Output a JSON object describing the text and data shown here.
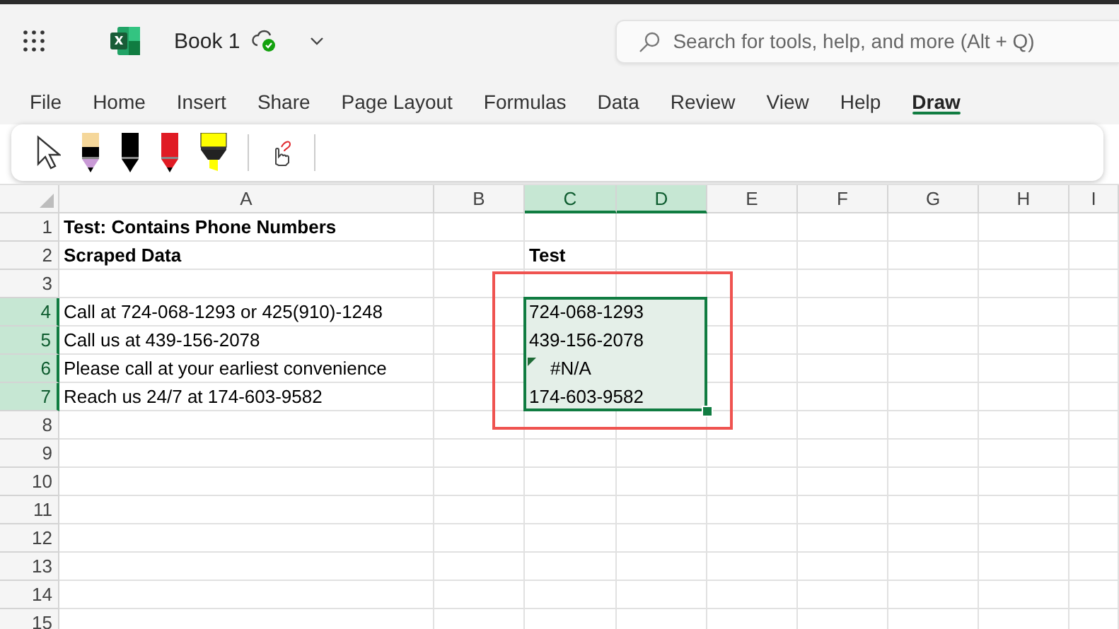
{
  "app": {
    "document_title": "Book 1",
    "search": {
      "placeholder": "Search for tools, help, and more (Alt + Q)"
    }
  },
  "tabs": [
    {
      "label": "File",
      "selected": false
    },
    {
      "label": "Home",
      "selected": false
    },
    {
      "label": "Insert",
      "selected": false
    },
    {
      "label": "Share",
      "selected": false
    },
    {
      "label": "Page Layout",
      "selected": false
    },
    {
      "label": "Formulas",
      "selected": false
    },
    {
      "label": "Data",
      "selected": false
    },
    {
      "label": "Review",
      "selected": false
    },
    {
      "label": "View",
      "selected": false
    },
    {
      "label": "Help",
      "selected": false
    },
    {
      "label": "Draw",
      "selected": true
    }
  ],
  "draw_tools": [
    {
      "kind": "select"
    },
    {
      "kind": "tip-pen",
      "color": "#000000"
    },
    {
      "kind": "pen",
      "color": "#000000"
    },
    {
      "kind": "pen",
      "color": "#e01b24"
    },
    {
      "kind": "highlighter",
      "color": "#ffff00"
    },
    {
      "kind": "separator"
    },
    {
      "kind": "ink-touch"
    },
    {
      "kind": "separator"
    }
  ],
  "sheet": {
    "columns": [
      {
        "label": "A",
        "selected": false
      },
      {
        "label": "B",
        "selected": false
      },
      {
        "label": "C",
        "selected": true
      },
      {
        "label": "D",
        "selected": true
      },
      {
        "label": "E",
        "selected": false
      },
      {
        "label": "F",
        "selected": false
      },
      {
        "label": "G",
        "selected": false
      },
      {
        "label": "H",
        "selected": false
      },
      {
        "label": "I",
        "selected": false
      }
    ],
    "rows": [
      {
        "number": "1",
        "selected": false,
        "cells": {
          "A": {
            "text": "Test: Contains Phone Numbers",
            "bold": true
          }
        }
      },
      {
        "number": "2",
        "selected": false,
        "cells": {
          "A": {
            "text": "Scraped Data",
            "bold": true
          },
          "C": {
            "text": "Test",
            "bold": true
          }
        }
      },
      {
        "number": "3",
        "selected": false,
        "cells": {}
      },
      {
        "number": "4",
        "selected": true,
        "cells": {
          "A": {
            "text": "Call at 724-068-1293 or 425(910)-1248"
          },
          "C": {
            "text": "724-068-1293"
          }
        }
      },
      {
        "number": "5",
        "selected": true,
        "cells": {
          "A": {
            "text": "Call us at 439-156-2078"
          },
          "C": {
            "text": "439-156-2078"
          }
        }
      },
      {
        "number": "6",
        "selected": true,
        "cells": {
          "A": {
            "text": "Please call at your earliest convenience"
          },
          "C": {
            "text": "#N/A",
            "error": true
          }
        }
      },
      {
        "number": "7",
        "selected": true,
        "cells": {
          "A": {
            "text": "Reach us 24/7 at 174-603-9582"
          },
          "C": {
            "text": "174-603-9582"
          }
        }
      },
      {
        "number": "8",
        "selected": false,
        "cells": {}
      },
      {
        "number": "9",
        "selected": false,
        "cells": {}
      },
      {
        "number": "10",
        "selected": false,
        "cells": {}
      },
      {
        "number": "11",
        "selected": false,
        "cells": {}
      },
      {
        "number": "12",
        "selected": false,
        "cells": {}
      },
      {
        "number": "13",
        "selected": false,
        "cells": {}
      },
      {
        "number": "14",
        "selected": false,
        "cells": {}
      },
      {
        "number": "15",
        "selected": false,
        "cells": {}
      }
    ]
  }
}
